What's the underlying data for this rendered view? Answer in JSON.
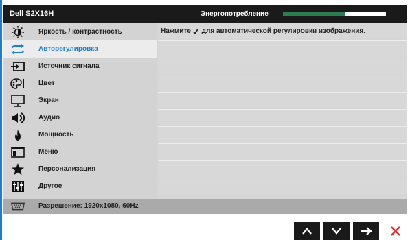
{
  "osd": {
    "model": "Dell S2X16H",
    "energy_label": "Энергопотребление",
    "energy_level": 0.6
  },
  "menu": {
    "items": [
      {
        "label": "Яркость / контрастность",
        "icon": "brightness-icon",
        "selected": false
      },
      {
        "label": "Авторегулировка",
        "icon": "auto-adjust-icon",
        "selected": true
      },
      {
        "label": "Источник сигнала",
        "icon": "input-source-icon",
        "selected": false
      },
      {
        "label": "Цвет",
        "icon": "color-icon",
        "selected": false
      },
      {
        "label": "Экран",
        "icon": "display-icon",
        "selected": false
      },
      {
        "label": "Аудио",
        "icon": "audio-icon",
        "selected": false
      },
      {
        "label": "Мощность",
        "icon": "power-icon",
        "selected": false
      },
      {
        "label": "Меню",
        "icon": "menu-icon",
        "selected": false
      },
      {
        "label": "Персонализация",
        "icon": "star-icon",
        "selected": false
      },
      {
        "label": "Другое",
        "icon": "other-icon",
        "selected": false
      }
    ]
  },
  "content": {
    "message_prefix": "Нажмите",
    "check_glyph": "✓",
    "message_suffix": "для автоматической регулировки изображения."
  },
  "status": {
    "resolution": "Разрешение: 1920x1080, 60Hz",
    "icon": "monitor-port-icon"
  },
  "nav": {
    "buttons": [
      "up-button",
      "down-button",
      "enter-button",
      "close-button"
    ]
  },
  "colors": {
    "accent": "#1e7dd0",
    "energy_fill": "#2e7d50",
    "close": "#e03030"
  }
}
